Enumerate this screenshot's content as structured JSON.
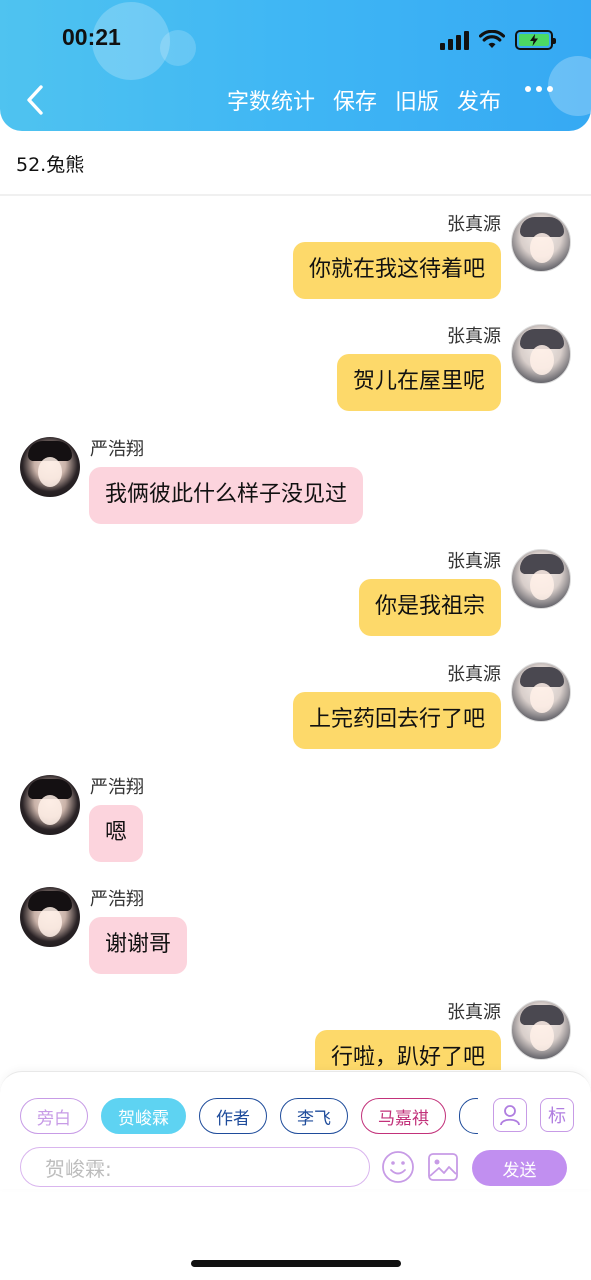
{
  "status_bar": {
    "time": "00:21"
  },
  "header": {
    "actions": [
      "字数统计",
      "保存",
      "旧版",
      "发布"
    ]
  },
  "chapter": {
    "title": "52.兔熊"
  },
  "messages": [
    {
      "side": "right",
      "sender": "张真源",
      "text": "你就在我这待着吧"
    },
    {
      "side": "right",
      "sender": "张真源",
      "text": "贺儿在屋里呢"
    },
    {
      "side": "left",
      "sender": "严浩翔",
      "text": "我俩彼此什么样子没见过"
    },
    {
      "side": "right",
      "sender": "张真源",
      "text": "你是我祖宗"
    },
    {
      "side": "right",
      "sender": "张真源",
      "text": "上完药回去行了吧"
    },
    {
      "side": "left",
      "sender": "严浩翔",
      "text": "嗯"
    },
    {
      "side": "left",
      "sender": "严浩翔",
      "text": "谢谢哥"
    },
    {
      "side": "right",
      "sender": "张真源",
      "text": "行啦，趴好了吧"
    }
  ],
  "roles": [
    {
      "label": "旁白",
      "color": "#c79be6",
      "active": false
    },
    {
      "label": "贺峻霖",
      "color": "#5ed3f2",
      "active": true
    },
    {
      "label": "作者",
      "color": "#1f4c9b",
      "active": false
    },
    {
      "label": "李飞",
      "color": "#1f4c9b",
      "active": false
    },
    {
      "label": "马嘉祺",
      "color": "#c2317a",
      "active": false
    },
    {
      "label": "",
      "color": "#1f4c9b",
      "active": false
    }
  ],
  "panel": {
    "tag_icon_label": "标",
    "input_placeholder": "贺峻霖:",
    "send_label": "发送"
  }
}
